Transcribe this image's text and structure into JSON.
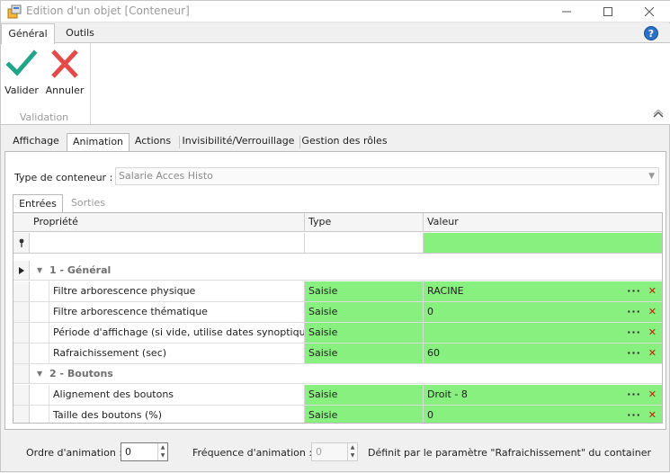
{
  "window": {
    "title": "Edition d'un objet [Conteneur]",
    "controls": [
      "minimize",
      "maximize",
      "close"
    ]
  },
  "ribbon": {
    "tabs": [
      {
        "label": "Général",
        "active": true
      },
      {
        "label": "Outils",
        "active": false
      }
    ],
    "buttons": [
      {
        "label": "Valider",
        "icon": "checkmark-icon",
        "color": "#22a58a"
      },
      {
        "label": "Annuler",
        "icon": "cross-icon",
        "color": "#e34b4b"
      }
    ],
    "group_label": "Validation"
  },
  "main_tabs": [
    {
      "label": "Affichage",
      "active": false
    },
    {
      "label": "Animation",
      "active": true
    },
    {
      "label": "Actions",
      "active": false
    },
    {
      "label": "Invisibilité/Verrouillage",
      "active": false
    },
    {
      "label": "Gestion des rôles",
      "active": false
    }
  ],
  "container": {
    "type_label": "Type de conteneur :",
    "type_value": "Salarie Acces Histo"
  },
  "sub_tabs": [
    {
      "label": "Entrées",
      "active": true
    },
    {
      "label": "Sorties",
      "active": false
    }
  ],
  "grid": {
    "columns": [
      "Propriété",
      "Type",
      "Valeur"
    ],
    "groups": [
      {
        "label": "1 - Général",
        "rows": [
          {
            "property": "Filtre arborescence physique",
            "type": "Saisie",
            "value": "RACINE"
          },
          {
            "property": "Filtre arborescence thématique",
            "type": "Saisie",
            "value": "0"
          },
          {
            "property": "Période d'affichage (si vide, utilise dates synoptique)",
            "type": "Saisie",
            "value": ""
          },
          {
            "property": "Rafraichissement (sec)",
            "type": "Saisie",
            "value": "60"
          }
        ]
      },
      {
        "label": "2 - Boutons",
        "rows": [
          {
            "property": "Alignement des boutons",
            "type": "Saisie",
            "value": "Droit - 8"
          },
          {
            "property": "Taille des boutons (%)",
            "type": "Saisie",
            "value": "0"
          }
        ]
      }
    ],
    "row_action_ellipsis": "···",
    "row_action_delete": "✕",
    "highlight_color": "#88f07e"
  },
  "footer": {
    "order_label": "Ordre d'animation :",
    "order_value": "0",
    "frequency_label": "Fréquence d'animation :",
    "frequency_value": "0",
    "frequency_note": "Définit par le paramètre \"Rafraichissement\" du container"
  }
}
